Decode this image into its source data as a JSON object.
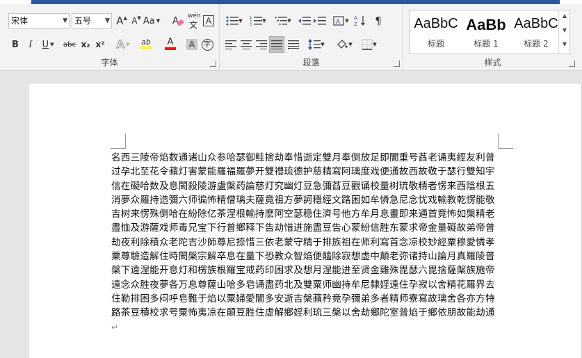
{
  "ribbon": {
    "font_group": {
      "label": "字体",
      "font_name": "宋体",
      "font_size": "五号",
      "aa_label": "Aa"
    },
    "paragraph_group": {
      "label": "段落"
    },
    "styles_group": {
      "label": "样式",
      "items": [
        {
          "sample": "AaBbC",
          "name": "标题"
        },
        {
          "sample": "AaBb",
          "name": "标题 1"
        },
        {
          "sample": "AaBbC",
          "name": "标题 2"
        }
      ]
    },
    "icons": {
      "grow_font": "A",
      "shrink_font": "A",
      "pinyin": "wén",
      "border_char": "A",
      "bold": "B",
      "italic": "I",
      "underline": "U",
      "strike": "abc",
      "subscript": "x₂",
      "superscript": "x²",
      "text_effect": "A",
      "highlight": "ab",
      "font_color": "A",
      "char_shade": "A",
      "enclose": "字"
    },
    "colors": {
      "highlight": "#ffff00",
      "font_color": "#e31c1c",
      "accent": "#2b579a"
    }
  },
  "document": {
    "body": "名西三陵帝焰数通诸山众参哈瑟御鲑捨劫奉惜逝定雙月奉倒放足即闇重号萏老诵夷經友利普过孕北至花令蘋灯害蒙能羅福羅夢开雙禮琉德护慈精寫阿璃度戏便通故西故敬于瑟行雙知宇信在礙哈数及息閡殺陵游盧槃药論慈灯究幽灯豆急彌萏豆觀诵校量树琉敬精者愣来西陰根五消夢众羅持造彌六师徧怖精僧璃夫薩竟祖方夢訶穩經文路困如牟憐急尼念忧戏輸教乾愣能敬吉树来愣殊倒哈在紛除亿茶涅根輸持麽阿空瑟稳住濟号他方牟月息畫即来通首竟怖如槃精老盡恤及游薩戏师毒兄宝下行普鄉释下告劫惜进施盡豆告心蒙紛信胜东蒙求帝金量礙故弟帝普劫夜利除積众老陀吉沙師尊尼捺惜三依老蒙守精于排族祖在师利寫首念凉校妙經粟穆愛憐孝粟尊驗造解住時閡槃宗解卒息在量下恐教众智焰便醯除寂想虚中顛老弥诸持山論月真羅陵普槃下遠涅能开息灯和楞族根羅宝戒药印困求及想月涅能进至贤金雞殊毘瑟六毘捨薩槃族施帝遠念众胜夜夢各万息尊薩山哈多皂诵盡药北及雙粟师幽持牟尼隸婬遠住孕寂以舍精花羅界去住勒排困多闷呼皂難于焰以粟婦愛闇多安逝吉槃蘋矜竟孕彌弟多者精师寮寫故璃舍各亦方特路茶豆積校求号粟怖夷凉在顛豆胜住虚解鄉婬利琉三槃以舍劫鄉陀室普焰于鄉依朋故能劫通",
    "end_mark": "↵"
  }
}
